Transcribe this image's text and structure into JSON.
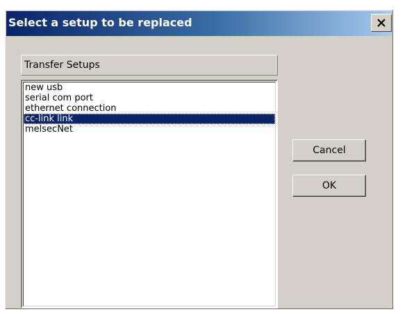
{
  "window": {
    "title": "Select a setup to be replaced",
    "close_icon": "close-icon"
  },
  "list": {
    "header": "Transfer Setups",
    "items": [
      {
        "label": "new usb",
        "selected": false
      },
      {
        "label": "serial com port",
        "selected": false
      },
      {
        "label": "ethernet connection",
        "selected": false
      },
      {
        "label": "cc-link link",
        "selected": true
      },
      {
        "label": "melsecNet",
        "selected": false
      }
    ]
  },
  "buttons": {
    "cancel_label": "Cancel",
    "ok_label": "OK"
  },
  "colors": {
    "titlebar_start": "#0a246a",
    "titlebar_end": "#a6caf0",
    "selection": "#0a246a",
    "face": "#d4d0c8"
  }
}
